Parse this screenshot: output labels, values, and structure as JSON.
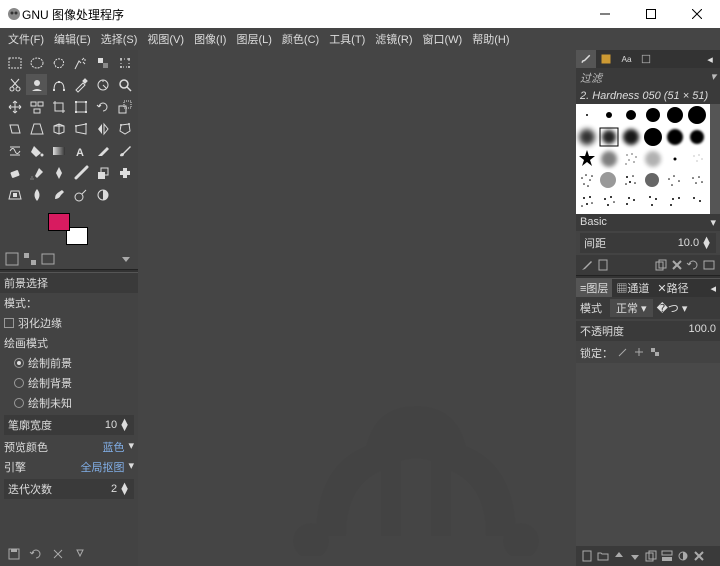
{
  "window": {
    "title": "GNU 图像处理程序"
  },
  "menu": {
    "file": "文件(F)",
    "edit": "编辑(E)",
    "select": "选择(S)",
    "view": "视图(V)",
    "image": "图像(I)",
    "layer": "图层(L)",
    "color": "颜色(C)",
    "tools": "工具(T)",
    "filters": "滤镜(R)",
    "windows": "窗口(W)",
    "help": "帮助(H)"
  },
  "toolopts": {
    "title": "前景选择",
    "mode_label": "模式：",
    "feather": "羽化边缘",
    "drawmode": "绘画模式",
    "draw_fg": "绘制前景",
    "draw_bg": "绘制背景",
    "draw_unknown": "绘制未知",
    "stroke_width_label": "笔廓宽度",
    "stroke_width_val": "10",
    "preview_color_label": "预览颜色",
    "preview_color_val": "蓝色",
    "engine_label": "引擎",
    "engine_val": "全局抠图",
    "iterations_label": "迭代次数",
    "iterations_val": "2"
  },
  "brushes": {
    "filter": "过滤",
    "current": "2. Hardness 050 (51 × 51)",
    "preset": "Basic",
    "spacing_label": "间距",
    "spacing_val": "10.0"
  },
  "layers_panel": {
    "tab_layers": "图层",
    "tab_channels": "通道",
    "tab_paths": "路径",
    "mode_label": "模式",
    "mode_val": "正常",
    "opacity_label": "不透明度",
    "opacity_val": "100.0",
    "lock_label": "锁定："
  },
  "colors": {
    "fg": "#d81b60",
    "bg": "#ffffff"
  }
}
